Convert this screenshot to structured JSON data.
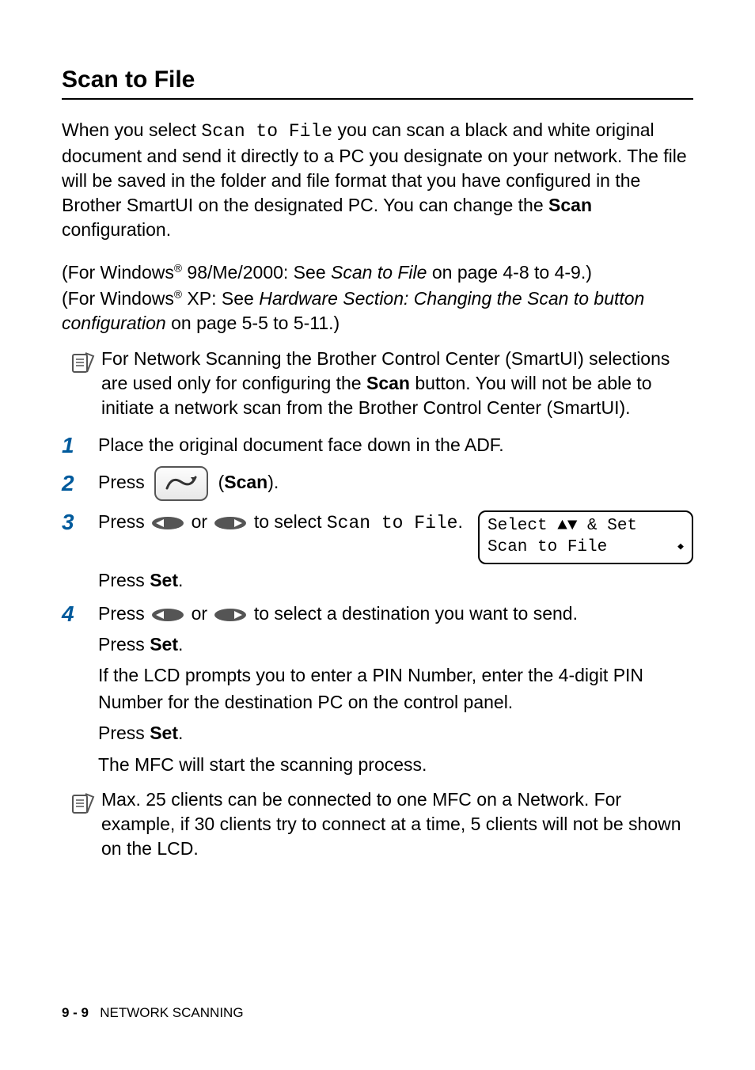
{
  "title": "Scan to File",
  "intro": {
    "pre": "When you select ",
    "mono": "Scan to File",
    "post": " you can scan a black and white original document and send it directly to a PC you designate on your network. The file will be saved in the folder and file format that you have configured in the Brother SmartUI on the designated PC. You can change the ",
    "bold": "Scan",
    "tail": " configuration."
  },
  "xrefs": {
    "line1": {
      "pre": "(For Windows",
      "sup": "®",
      "mid": " 98/Me/2000: See ",
      "link": "Scan to File",
      "post": " on page 4-8 to 4-9.)"
    },
    "line2": {
      "pre": "(For Windows",
      "sup": "®",
      "mid": " XP: See ",
      "link": "Hardware Section: Changing the Scan to button configuration",
      "post": " on page 5-5 to 5-11.)"
    }
  },
  "note1": {
    "pre": "For Network Scanning the Brother Control Center (SmartUI) selections are used only for configuring the ",
    "bold": "Scan",
    "post": " button. You will not be able to initiate a network scan from the Brother Control Center (SmartUI)."
  },
  "steps": {
    "s1": "Place the original document face down in the ADF.",
    "s2": {
      "pre": "Press ",
      "post_open": " (",
      "bold": "Scan",
      "post_close": ")."
    },
    "s3": {
      "line1_pre": "Press ",
      "line1_mid": " or ",
      "line1_post": " to select ",
      "mono": "Scan to File",
      "period": ".",
      "press": "Press ",
      "set": "Set",
      "end": "."
    },
    "s4": {
      "line1_pre": "Press ",
      "line1_mid": " or ",
      "line1_post": " to select a destination you want to send.",
      "press1": "Press ",
      "set1": "Set",
      "end1": ".",
      "pin": "If the LCD prompts you to enter a PIN Number, enter the 4-digit PIN Number for the destination PC on the control panel.",
      "press2": "Press ",
      "set2": "Set",
      "end2": ".",
      "final": "The MFC will start the scanning process."
    }
  },
  "lcd": {
    "line1": "Select ▲▼ & Set",
    "line2_text": "Scan to File"
  },
  "note2": "Max. 25 clients can be connected to one MFC on a Network. For example, if 30 clients try to connect at a time, 5 clients will not be shown on the LCD.",
  "footer": {
    "page": "9 - 9",
    "chapter": "   NETWORK SCANNING"
  }
}
